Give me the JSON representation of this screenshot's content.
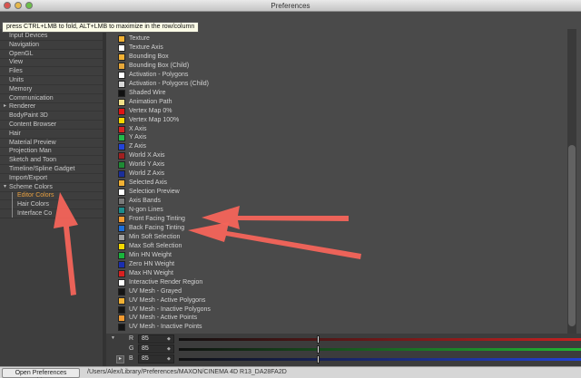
{
  "window": {
    "title": "Preferences"
  },
  "tooltip": "press CTRL+LMB to fold, ALT+LMB to maximize in the row/column",
  "tree": {
    "items": [
      {
        "label": "Input Devices",
        "level": 0,
        "active": false
      },
      {
        "label": "Navigation",
        "level": 0,
        "active": false
      },
      {
        "label": "OpenGL",
        "level": 0,
        "active": false
      },
      {
        "label": "View",
        "level": 0,
        "active": false
      },
      {
        "label": "Files",
        "level": 0,
        "active": false
      },
      {
        "label": "Units",
        "level": 0,
        "active": false
      },
      {
        "label": "Memory",
        "level": 0,
        "active": false
      },
      {
        "label": "Communication",
        "level": 0,
        "active": false
      },
      {
        "label": "Renderer",
        "level": 0,
        "active": false
      },
      {
        "label": "BodyPaint 3D",
        "level": 0,
        "active": false
      },
      {
        "label": "Content Browser",
        "level": 0,
        "active": false
      },
      {
        "label": "Hair",
        "level": 0,
        "active": false
      },
      {
        "label": "Material Preview",
        "level": 0,
        "active": false
      },
      {
        "label": "Projection Man",
        "level": 0,
        "active": false
      },
      {
        "label": "Sketch and Toon",
        "level": 0,
        "active": false
      },
      {
        "label": "Timeline/Spline Gadget",
        "level": 0,
        "active": false
      },
      {
        "label": "Import/Export",
        "level": 0,
        "active": false
      },
      {
        "label": "Scheme Colors",
        "level": 0,
        "active": false
      },
      {
        "label": "Editor Colors",
        "level": 1,
        "active": true
      },
      {
        "label": "Hair Colors",
        "level": 1,
        "active": false
      },
      {
        "label": "Interface Co",
        "level": 1,
        "active": false
      }
    ]
  },
  "colors": [
    {
      "label": "Texture",
      "color": "#f2b134"
    },
    {
      "label": "Texture Axis",
      "color": "#ffffff"
    },
    {
      "label": "Bounding Box",
      "color": "#f2b134"
    },
    {
      "label": "Bounding Box (Child)",
      "color": "#e6a73a"
    },
    {
      "label": "Activation - Polygons",
      "color": "#ffffff"
    },
    {
      "label": "Activation - Polygons (Child)",
      "color": "#d8d8d8"
    },
    {
      "label": "Shaded Wire",
      "color": "#111111"
    },
    {
      "label": "Animation Path",
      "color": "#f0e08a"
    },
    {
      "label": "Vertex Map 0%",
      "color": "#e01515"
    },
    {
      "label": "Vertex Map 100%",
      "color": "#f5d800"
    },
    {
      "label": "X Axis",
      "color": "#d32222"
    },
    {
      "label": "Y Axis",
      "color": "#22b84a"
    },
    {
      "label": "Z Axis",
      "color": "#2244d8"
    },
    {
      "label": "World X Axis",
      "color": "#a02020"
    },
    {
      "label": "World Y Axis",
      "color": "#1e8a34"
    },
    {
      "label": "World Z Axis",
      "color": "#1a2e9a"
    },
    {
      "label": "Selected Axis",
      "color": "#f2b134"
    },
    {
      "label": "Selection Preview",
      "color": "#ffffff"
    },
    {
      "label": "Axis Bands",
      "color": "#7a7a7a"
    },
    {
      "label": "N-gon Lines",
      "color": "#1d8c8c"
    },
    {
      "label": "Front Facing Tinting",
      "color": "#f29a30"
    },
    {
      "label": "Back Facing Tinting",
      "color": "#1e6ed8"
    },
    {
      "label": "Min Soft Selection",
      "color": "#a0a0a0"
    },
    {
      "label": "Max Soft Selection",
      "color": "#f5d800"
    },
    {
      "label": "Min HN Weight",
      "color": "#19b43c"
    },
    {
      "label": "Zero HN Weight",
      "color": "#1a2eb0"
    },
    {
      "label": "Max HN Weight",
      "color": "#d82020"
    },
    {
      "label": "Interactive Render Region",
      "color": "#ffffff"
    },
    {
      "label": "UV Mesh - Grayed",
      "color": "#151515"
    },
    {
      "label": "UV Mesh - Active Polygons",
      "color": "#f2b134"
    },
    {
      "label": "UV Mesh - Inactive Polygons",
      "color": "#151515"
    },
    {
      "label": "UV Mesh - Active Points",
      "color": "#f29a30"
    },
    {
      "label": "UV Mesh - Inactive Points",
      "color": "#151515"
    }
  ],
  "rgb": {
    "r": {
      "label": "R",
      "value": "85",
      "track": "#cc2222"
    },
    "g": {
      "label": "G",
      "value": "85",
      "track": "#22bb33"
    },
    "b": {
      "label": "B",
      "value": "85",
      "track": "#2244dd"
    }
  },
  "statusbar": {
    "button": "Open Preferences Folder...",
    "path": "/Users/Alex/Library/Preferences/MAXON/CINEMA 4D R13_DA28FA2D"
  },
  "accent": "#f4645a"
}
